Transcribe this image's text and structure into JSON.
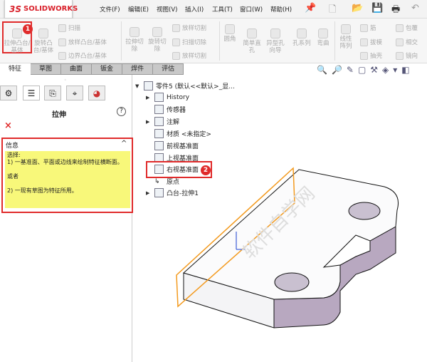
{
  "app": {
    "logo": "SOLIDWORKS",
    "logo_prefix": "3S"
  },
  "menu": [
    "文件(F)",
    "编辑(E)",
    "视图(V)",
    "插入(I)",
    "工具(T)",
    "窗口(W)",
    "帮助(H)"
  ],
  "ribbon": {
    "extrude_boss": "拉伸凸台/基体",
    "revolve_boss": "旋转凸台/基体",
    "sweep": "扫描",
    "loft_boss": "放样凸台/基体",
    "boundary_boss": "边界凸台/基体",
    "extrude_cut": "拉伸切除",
    "revolve_cut": "旋转切除",
    "loft_cut": "放样切割",
    "sweep_cut": "扫描切除",
    "loft_cut2": "放样切割",
    "fillet": "圆角",
    "simple_hole": "简单直孔",
    "hole_wizard": "异型孔向导",
    "hole_series": "孔系列",
    "flex": "弯曲",
    "linear_pattern": "线性阵列",
    "rib": "筋",
    "draft": "拔模",
    "shell": "抽壳",
    "wrap": "包覆",
    "intersect": "相交",
    "mirror": "镜向"
  },
  "badges": {
    "one": "1",
    "two": "2"
  },
  "tabs": [
    "特征",
    "草图",
    "曲面",
    "钣金",
    "焊件",
    "评估"
  ],
  "panel": {
    "title": "拉伸",
    "help": "?",
    "cancel": "×",
    "info_title": "信息",
    "collapse": "^",
    "info_lines": [
      "选择:",
      "1) 一基准面、平面或边线来绘制特征横断面。",
      "",
      "或者",
      "",
      "2) 一现有草图为特征所用。"
    ]
  },
  "tree": {
    "root": "零件5  (默认<<默认>_显...",
    "items": [
      "History",
      "传感器",
      "注解",
      "材质 <未指定>",
      "前视基准面",
      "上视基准面",
      "右视基准面",
      "原点",
      "凸台-拉伸1"
    ]
  },
  "watermark": "软件自学网 WWW.RJZXW.COM",
  "colors": {
    "accent_red": "#e02b2b",
    "plane_orange": "#f39a1e",
    "info_bg": "#f8f87a"
  }
}
